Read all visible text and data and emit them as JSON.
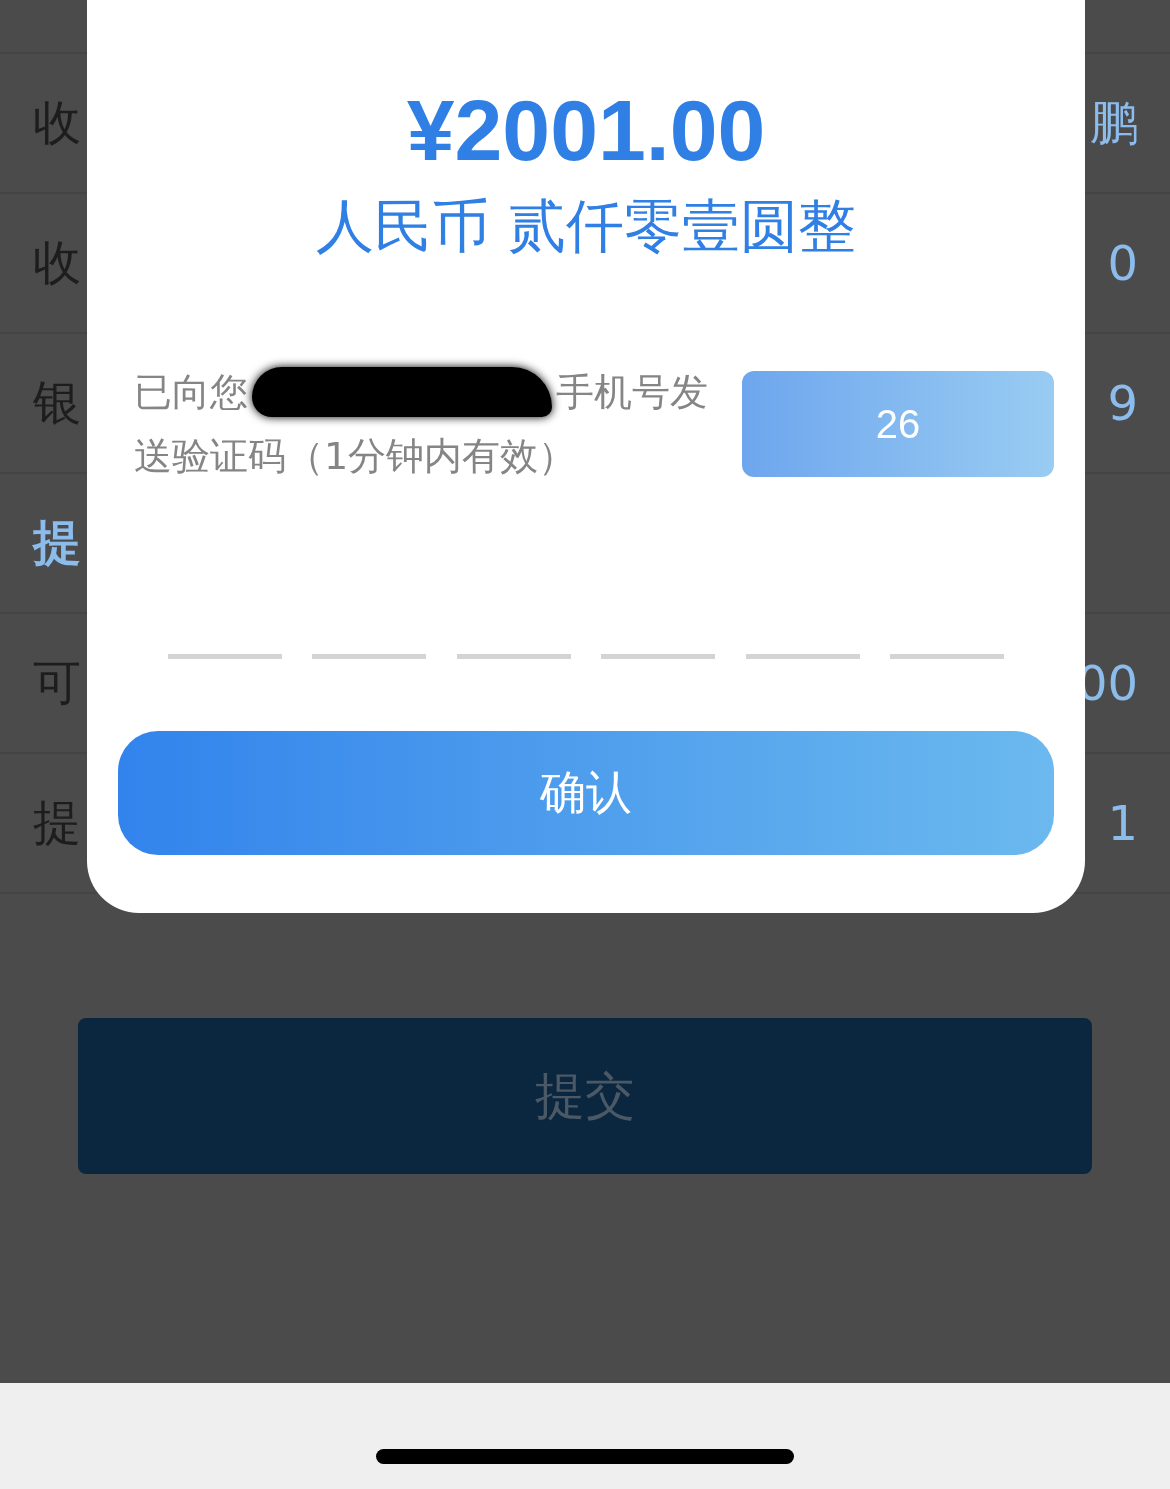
{
  "background_form": {
    "rows": [
      {
        "kind": "field",
        "label": "收",
        "value": "鹏"
      },
      {
        "kind": "field",
        "label": "收",
        "value": "0"
      },
      {
        "kind": "field",
        "label": "银",
        "value": "9"
      },
      {
        "kind": "section",
        "label": "提"
      },
      {
        "kind": "field",
        "label": "可",
        "value": "00"
      },
      {
        "kind": "field",
        "label": "提",
        "value": "1"
      }
    ],
    "submit_button": "提交"
  },
  "dialog": {
    "amount": "¥2001.00",
    "amount_in_words": "人民币 贰仟零壹圆整",
    "sms_notice": {
      "before": "已向您",
      "after": "手机号发",
      "second_line": "送验证码（1分钟内有效）"
    },
    "countdown_button": "26",
    "confirm_button": "确认"
  }
}
